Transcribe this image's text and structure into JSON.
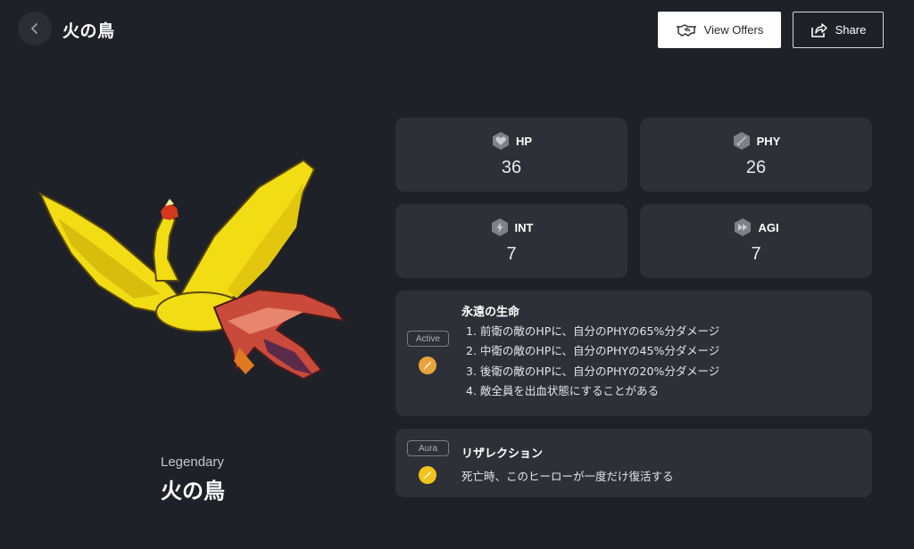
{
  "header": {
    "title": "火の鳥",
    "view_offers_label": "View Offers",
    "share_label": "Share"
  },
  "hero": {
    "rarity": "Legendary",
    "name": "火の鳥"
  },
  "stats": [
    {
      "label": "HP",
      "value": "36",
      "icon": "heart-hex-icon"
    },
    {
      "label": "PHY",
      "value": "26",
      "icon": "sword-hex-icon"
    },
    {
      "label": "INT",
      "value": "7",
      "icon": "lightning-hex-icon"
    },
    {
      "label": "AGI",
      "value": "7",
      "icon": "fast-forward-hex-icon"
    }
  ],
  "skills": [
    {
      "type": "Active",
      "name": "永遠の生命",
      "icon_color": "#e8a33a",
      "lines": [
        "1. 前衛の敵のHPに、自分のPHYの65%分ダメージ",
        "2. 中衛の敵のHPに、自分のPHYの45%分ダメージ",
        "3. 後衛の敵のHPに、自分のPHYの20%分ダメージ",
        "4. 敵全員を出血状態にすることがある"
      ]
    },
    {
      "type": "Aura",
      "name": "リザレクション",
      "icon_color": "#f0c419",
      "description": "死亡時、このヒーローが一度だけ復活する"
    }
  ],
  "colors": {
    "background": "#1f2129",
    "card": "#2e3038"
  }
}
